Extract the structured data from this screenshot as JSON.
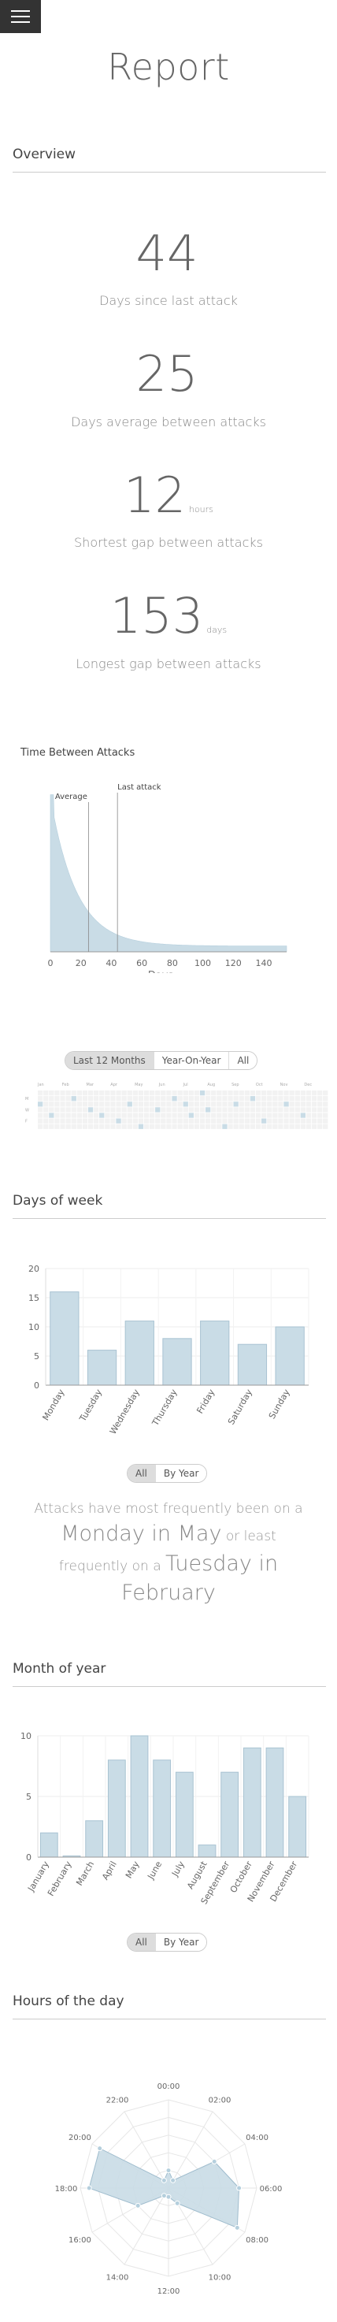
{
  "header": {
    "title": "Report",
    "menu_icon": "hamburger-menu-icon"
  },
  "overview": {
    "section_title": "Overview",
    "stats": [
      {
        "value": "44",
        "unit": "",
        "label": "Days since last attack"
      },
      {
        "value": "25",
        "unit": "",
        "label": "Days average between attacks"
      },
      {
        "value": "12",
        "unit": "hours",
        "label": "Shortest gap between attacks"
      },
      {
        "value": "153",
        "unit": "days",
        "label": "Longest gap between attacks"
      }
    ]
  },
  "time_between": {
    "title": "Time Between Attacks",
    "chart_data": {
      "type": "area",
      "title": "Time Between Attacks",
      "xlabel": "Days",
      "ylabel": "",
      "x_ticks": [
        0,
        20,
        40,
        60,
        80,
        100,
        120,
        140
      ],
      "xlim": [
        0,
        155
      ],
      "annotations": [
        {
          "label": "Average",
          "x": 25
        },
        {
          "label": "Last attack",
          "x": 44
        }
      ],
      "color": "#c9dce6"
    }
  },
  "calendar": {
    "tabs": [
      "Last 12 Months",
      "Year-On-Year",
      "All"
    ],
    "active_tab": "Last 12 Months",
    "months": [
      "Jan",
      "Feb",
      "Mar",
      "Apr",
      "May",
      "Jun",
      "Jul",
      "Aug",
      "Sep",
      "Oct",
      "Nov",
      "Dec"
    ],
    "days": [
      "M",
      "W",
      "F"
    ],
    "attack_days": [
      [
        0,
        2
      ],
      [
        2,
        4
      ],
      [
        6,
        1
      ],
      [
        9,
        3
      ],
      [
        11,
        4
      ],
      [
        14,
        5
      ],
      [
        16,
        2
      ],
      [
        18,
        6
      ],
      [
        21,
        3
      ],
      [
        24,
        1
      ],
      [
        26,
        2
      ],
      [
        27,
        4
      ],
      [
        29,
        0
      ],
      [
        30,
        3
      ],
      [
        33,
        6
      ],
      [
        35,
        2
      ],
      [
        38,
        1
      ],
      [
        40,
        5
      ],
      [
        44,
        2
      ],
      [
        47,
        4
      ]
    ]
  },
  "days_of_week": {
    "section_title": "Days of week",
    "chart_data": {
      "type": "bar",
      "categories": [
        "Monday",
        "Tuesday",
        "Wednesday",
        "Thursday",
        "Friday",
        "Saturday",
        "Sunday"
      ],
      "values": [
        16,
        6,
        11,
        8,
        11,
        7,
        10
      ],
      "ylim": [
        0,
        20
      ],
      "y_ticks": [
        0,
        5,
        10,
        15,
        20
      ],
      "color": "#c9dce6"
    },
    "tabs": [
      "All",
      "By Year"
    ],
    "active_tab": "All",
    "sentence": {
      "p1": "Attacks have most frequently been on a",
      "most": "Monday in May",
      "p2": "or least frequently on a",
      "least": "Tuesday in February"
    }
  },
  "month_of_year": {
    "section_title": "Month of year",
    "chart_data": {
      "type": "bar",
      "categories": [
        "January",
        "February",
        "March",
        "April",
        "May",
        "June",
        "July",
        "August",
        "September",
        "October",
        "November",
        "December"
      ],
      "values": [
        2,
        0.1,
        3,
        8,
        10,
        8,
        7,
        1,
        7,
        9,
        9,
        5
      ],
      "ylim": [
        0,
        10
      ],
      "y_ticks": [
        0,
        5,
        10
      ],
      "color": "#c9dce6"
    },
    "tabs": [
      "All",
      "By Year"
    ],
    "active_tab": "All"
  },
  "hours_of_day": {
    "section_title": "Hours of the day",
    "chart_data": {
      "type": "radar",
      "labels": [
        "00:00",
        "02:00",
        "04:00",
        "06:00",
        "08:00",
        "10:00",
        "12:00",
        "14:00",
        "16:00",
        "18:00",
        "20:00",
        "22:00"
      ],
      "values": [
        2,
        1,
        6,
        8,
        9,
        2,
        1,
        1,
        4,
        9,
        9,
        1
      ],
      "r_max": 10,
      "color": "#c9dce6"
    }
  }
}
